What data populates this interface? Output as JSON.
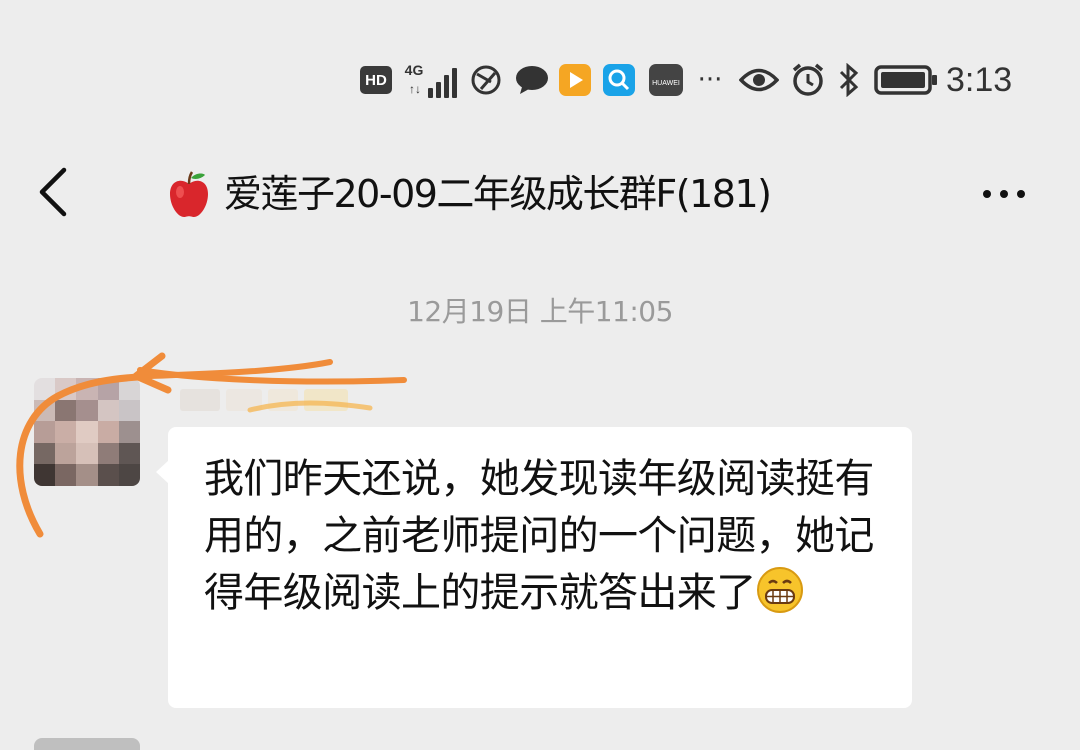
{
  "status_bar": {
    "hd_label": "HD",
    "network_label": "4G",
    "time": "3:13",
    "icons": [
      "hd-icon",
      "signal-4g-icon",
      "browser-icon",
      "chat-bubble-icon",
      "video-play-icon",
      "search-app-icon",
      "huawei-app-icon",
      "more-dots-icon",
      "eye-icon",
      "alarm-icon",
      "bluetooth-icon",
      "battery-icon"
    ],
    "huawei_label": "HUAWEI",
    "overflow": "···"
  },
  "nav": {
    "title": "爱莲子20-09二年级成长群F(181)",
    "title_emoji": "apple-icon"
  },
  "chat": {
    "timestamp": "12月19日 上午11:05",
    "message": {
      "text": "我们昨天还说，她发现读年级阅读挺有用的，之前老师提问的一个问题，她记得年级阅读上的提示就答出来了",
      "emoji": "grinning-face-emoji"
    }
  },
  "colors": {
    "background": "#ededed",
    "bubble": "#ffffff",
    "annotation": "#f08c3a"
  }
}
